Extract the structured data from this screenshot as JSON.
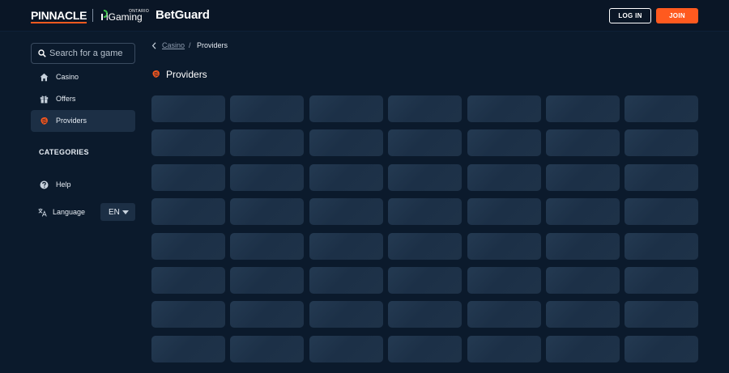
{
  "header": {
    "brand_pinnacle": "PINNACLE",
    "brand_igaming": "iGaming",
    "brand_ontario": "ONTARIO",
    "brand_betguard": "BetGuard",
    "login_label": "LOG IN",
    "join_label": "JOIN",
    "accent_color": "#ff5a1f"
  },
  "sidebar": {
    "search_placeholder": "Search for a game",
    "items": [
      {
        "label": "Casino",
        "icon": "home-icon",
        "active": false
      },
      {
        "label": "Offers",
        "icon": "gift-icon",
        "active": false
      },
      {
        "label": "Providers",
        "icon": "providers-icon",
        "active": true
      }
    ],
    "categories_heading": "CATEGORIES",
    "help_label": "Help",
    "language_label": "Language",
    "language_value": "EN"
  },
  "main": {
    "breadcrumb": {
      "parent": "Casino",
      "separator": "/",
      "current": "Providers"
    },
    "title": "Providers",
    "tile_grid": {
      "columns": 7,
      "rows_visible": 8,
      "state": "loading-skeleton"
    }
  }
}
